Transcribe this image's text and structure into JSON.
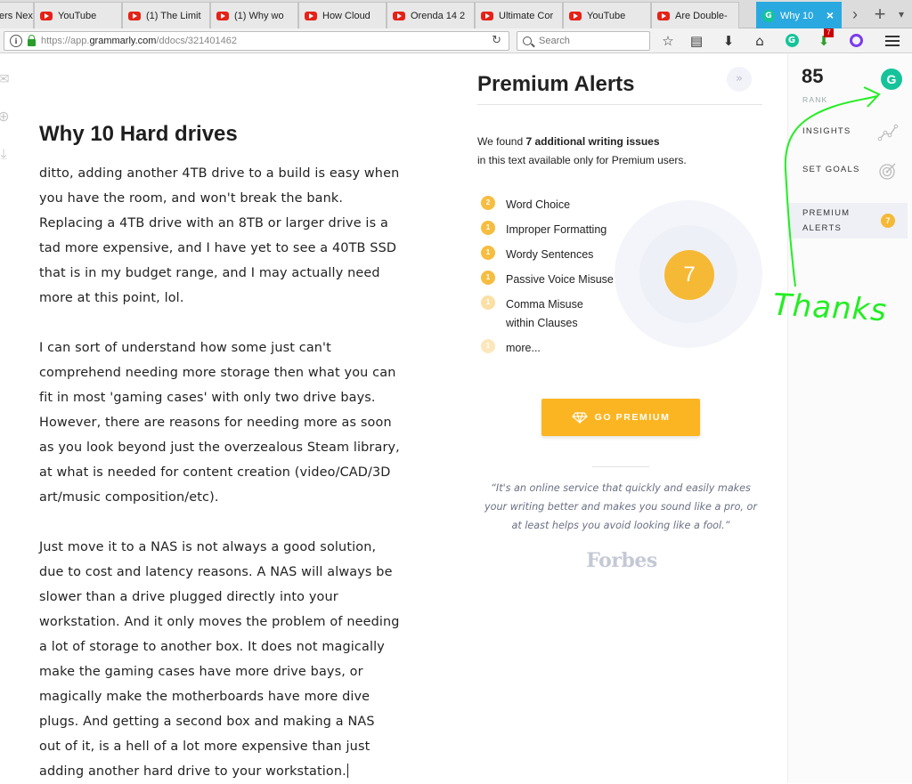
{
  "browser": {
    "tabs": [
      {
        "label": "ers Nex",
        "favicon": "none"
      },
      {
        "label": "YouTube",
        "favicon": "youtube-icon"
      },
      {
        "label": "(1) The Limit",
        "favicon": "youtube-icon"
      },
      {
        "label": "(1) Why wo",
        "favicon": "youtube-icon"
      },
      {
        "label": "How Cloud",
        "favicon": "youtube-icon"
      },
      {
        "label": "Orenda 14 2",
        "favicon": "youtube-icon"
      },
      {
        "label": "Ultimate Cor",
        "favicon": "youtube-icon"
      },
      {
        "label": "YouTube",
        "favicon": "youtube-icon"
      },
      {
        "label": "Are Double-",
        "favicon": "youtube-icon"
      },
      {
        "label": "Why 10",
        "favicon": "grammarly-icon",
        "active": true
      }
    ],
    "tab_close": "×",
    "tab_scroll": "›",
    "new_tab": "+",
    "url_prefix": "https://app.",
    "url_domain": "grammarly.com",
    "url_path": "/ddocs/321401462",
    "search_placeholder": "Search",
    "grammarly_icon_letter": "G",
    "download_badge": "7"
  },
  "document": {
    "title": "Why 10 Hard drives",
    "paragraphs": [
      "ditto, adding another 4TB drive to a build is easy when you have the room, and won't break the bank. Replacing a 4TB drive with an 8TB or larger drive is a tad more expensive, and I have yet to see a 40TB SSD that is in my budget range, and I may actually need more at this point, lol.",
      "I can sort of understand how some just can't comprehend needing more storage then what you can fit in most 'gaming cases' with only two drive bays. However, there are reasons for needing more as soon as you look beyond just the overzealous Steam library, at what is needed for content creation (video/CAD/3D art/music composition/etc).",
      "Just move it to a NAS is not always a good solution, due to cost and latency reasons. A NAS will always be slower than a drive plugged directly into your workstation. And it only moves the problem of needing a lot of storage to another box. It does not magically make the gaming cases have more drive bays, or magically make the motherboards have more dive plugs. And getting a second box and making a NAS out of it, is a hell of a lot more expensive than just adding another hard drive to your workstation."
    ]
  },
  "premium": {
    "title": "Premium Alerts",
    "collapse_glyph": "»",
    "found_prefix": "We found ",
    "found_bold": "7 additional writing issues",
    "found_suffix": "in this text available only for Premium users.",
    "issues": [
      {
        "count": "2",
        "label": "Word Choice"
      },
      {
        "count": "1",
        "label": "Improper Formatting"
      },
      {
        "count": "1",
        "label": "Wordy Sentences"
      },
      {
        "count": "1",
        "label": "Passive Voice Misuse"
      },
      {
        "count": "1",
        "label": "Comma Misuse",
        "label2": "within Clauses"
      },
      {
        "count": "1",
        "label": "more..."
      }
    ],
    "total": "7",
    "cta_label": "GO PREMIUM",
    "quote": "“It's an online service that quickly and easily makes your writing better and makes you sound like a pro, or at least helps you avoid looking like a fool.”",
    "quote_source": "Forbes"
  },
  "sidebar": {
    "score": "85",
    "score_label": "RANK",
    "logo_letter": "G",
    "items": [
      {
        "label": "INSIGHTS"
      },
      {
        "label": "SET GOALS"
      },
      {
        "label": "PREMIUM",
        "label2": "ALERTS",
        "badge": "7"
      }
    ]
  },
  "annotation": {
    "text": "Thanks",
    "color": "#22ee22"
  },
  "colors": {
    "accent_yellow": "#f6b935",
    "grammarly_green": "#15c39a",
    "active_tab": "#2aa9e0"
  }
}
